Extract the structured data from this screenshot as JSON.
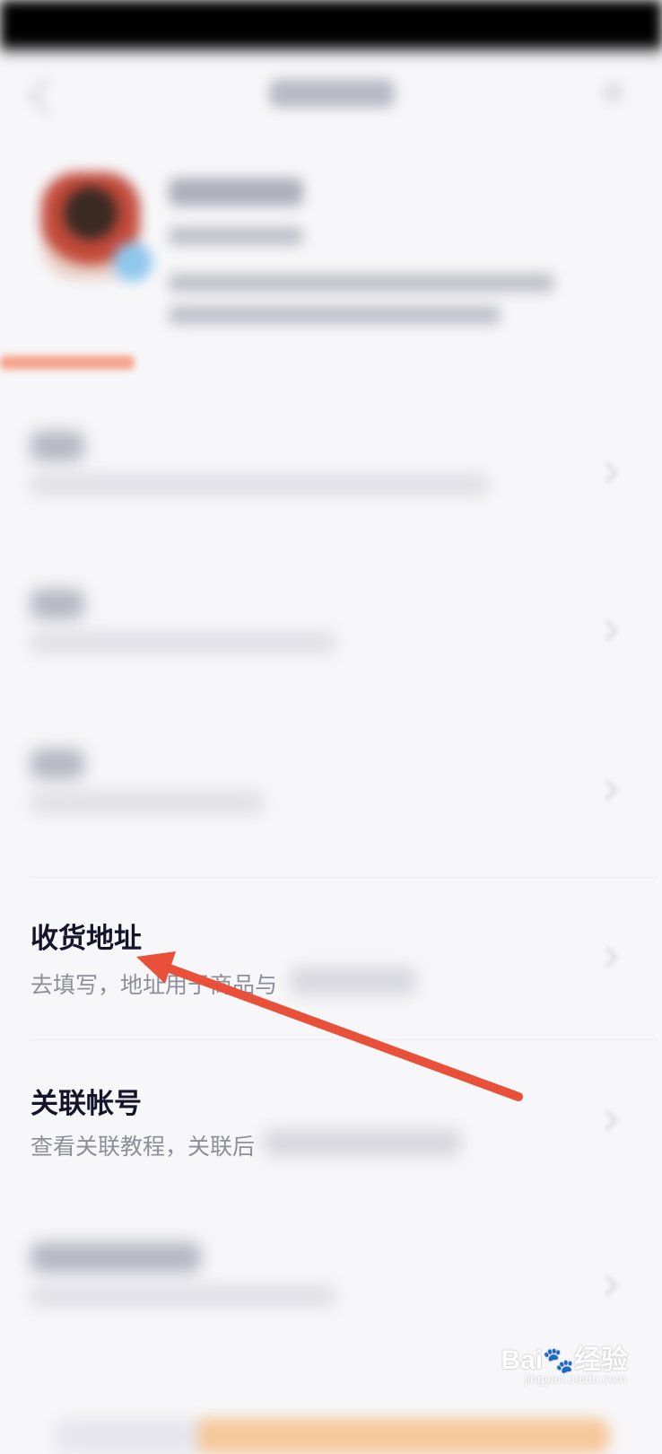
{
  "address_item": {
    "title": "收货地址",
    "subtitle_visible": "去填写，地址用于商品与"
  },
  "linked_item": {
    "title": "关联帐号",
    "subtitle_visible": "查看关联教程，关联后"
  },
  "annotation": {
    "arrow_color": "#e8503a",
    "points_to": "收货地址"
  },
  "watermark": {
    "brand": "Bai",
    "paw": "🐾",
    "brand_suffix": "经验",
    "url": "jingyan.baidu.com"
  },
  "colors": {
    "title": "#14142a",
    "subtitle": "#8e8e99",
    "background": "#f7f7f9",
    "accent": "#e8503a"
  }
}
